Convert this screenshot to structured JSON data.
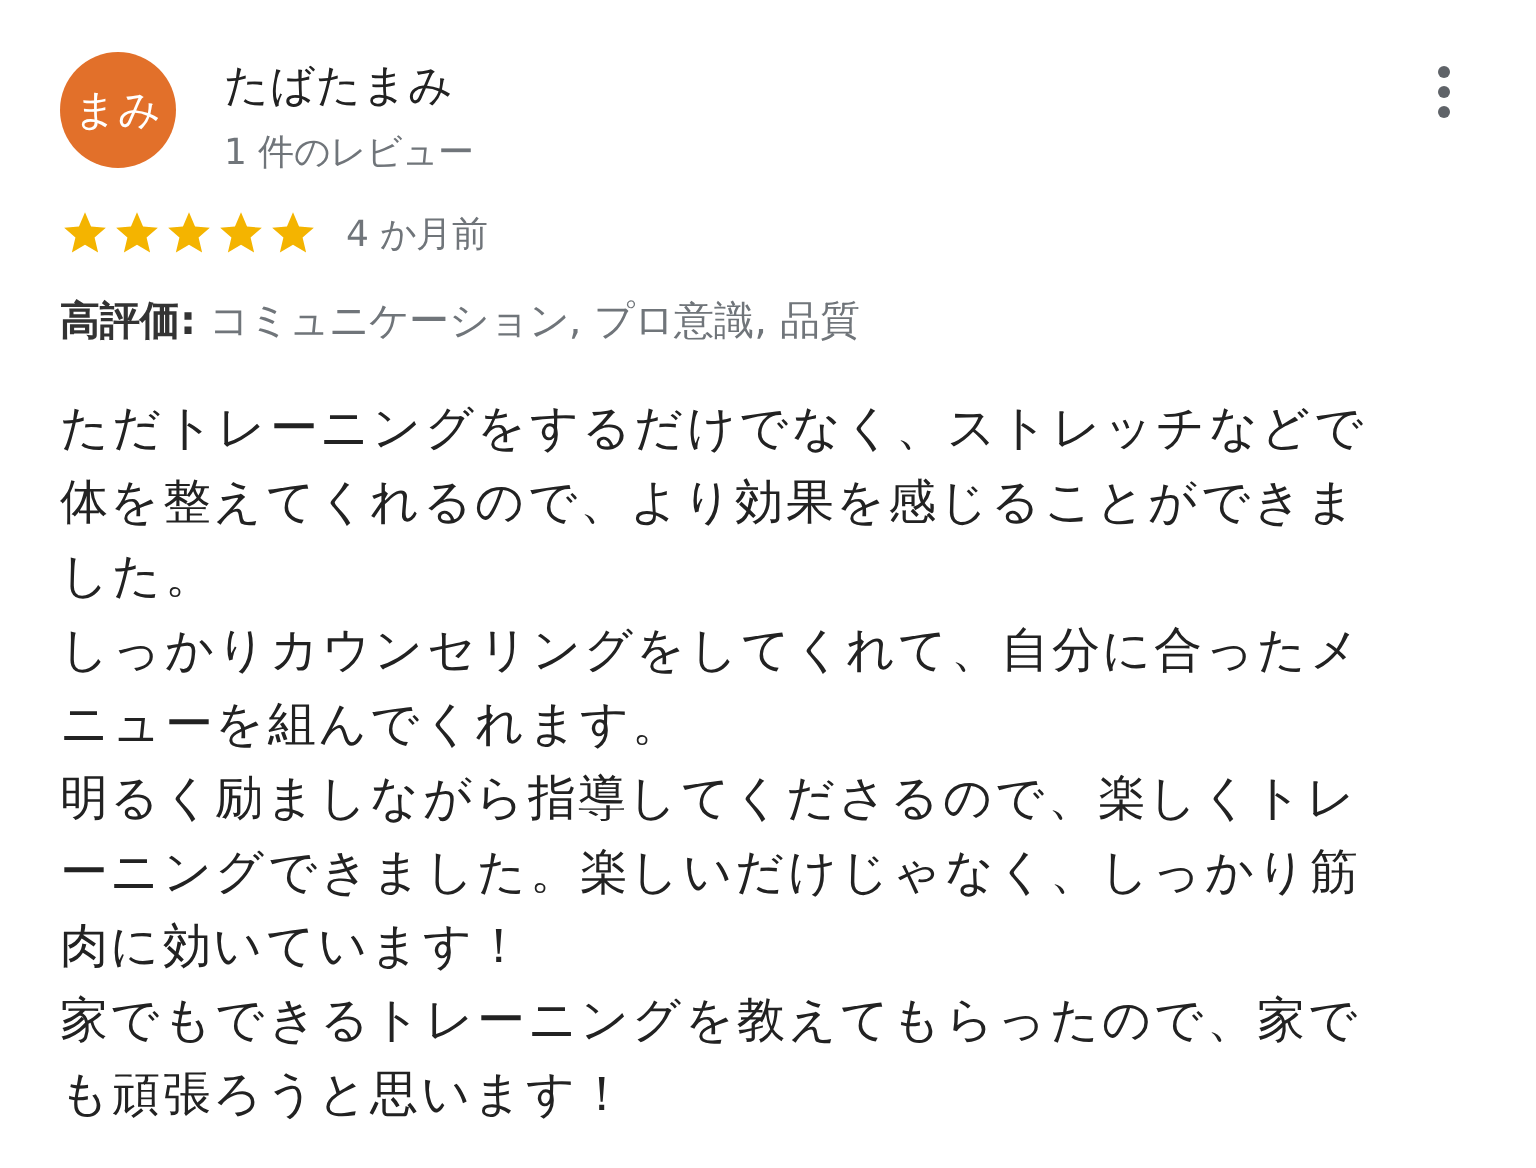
{
  "reviewer": {
    "avatar_text": "まみ",
    "color": "#e2702a",
    "name": "たばたまみ",
    "review_count": "1 件のレビュー"
  },
  "rating": {
    "stars": 5,
    "time": "4 か月前"
  },
  "highlights": {
    "label": "高評価:",
    "items": "コミュニケーション, プロ意識, 品質"
  },
  "body": [
    "ただトレーニングをするだけでなく、ストレッチなどで体を整えてくれるので、より効果を感じることができました。",
    "しっかりカウンセリングをしてくれて、自分に合ったメニューを組んでくれます。",
    "明るく励ましながら指導してくださるので、楽しくトレーニングできました。楽しいだけじゃなく、しっかり筋肉に効いています！",
    "家でもできるトレーニングを教えてもらったので、家でも頑張ろうと思います！"
  ]
}
